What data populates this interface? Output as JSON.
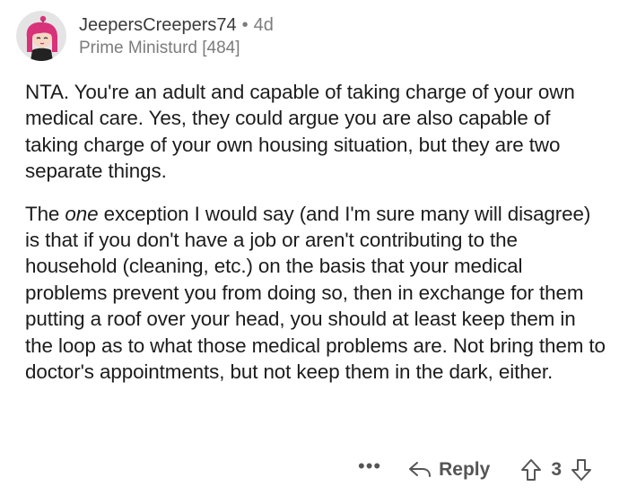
{
  "comment": {
    "username": "JeepersCreepers74",
    "separator": "•",
    "age": "4d",
    "flair": "Prime Ministurd [484]",
    "avatar_icon": "avatar-pink-hair-character",
    "paragraph_1": "NTA. You're an adult and capable of taking charge of your own medical care.  Yes, they could argue you are also capable of taking charge of your own housing situation, but they are two separate things.",
    "paragraph_2_before": "The ",
    "paragraph_2_emphasis": "one",
    "paragraph_2_after": " exception I would say (and I'm sure many will disagree) is that if you don't have a job or aren't contributing to the household (cleaning, etc.) on the basis that your medical problems prevent you from doing so, then in exchange for them putting a roof over your head, you should at least keep them in the loop as to what those medical problems are.  Not bring them to doctor's appointments, but not keep them in the dark, either."
  },
  "actions": {
    "more_label": "•••",
    "reply_label": "Reply",
    "score": "3",
    "more_icon": "ellipsis-icon",
    "reply_icon": "reply-arrow-icon",
    "upvote_icon": "upvote-arrow-icon",
    "downvote_icon": "downvote-arrow-icon"
  },
  "colors": {
    "text_primary": "#1c1c1c",
    "text_meta": "#7c7c7c",
    "action_gray": "#555555",
    "avatar_bg": "#e4e4e4",
    "avatar_hair": "#d8327a"
  }
}
